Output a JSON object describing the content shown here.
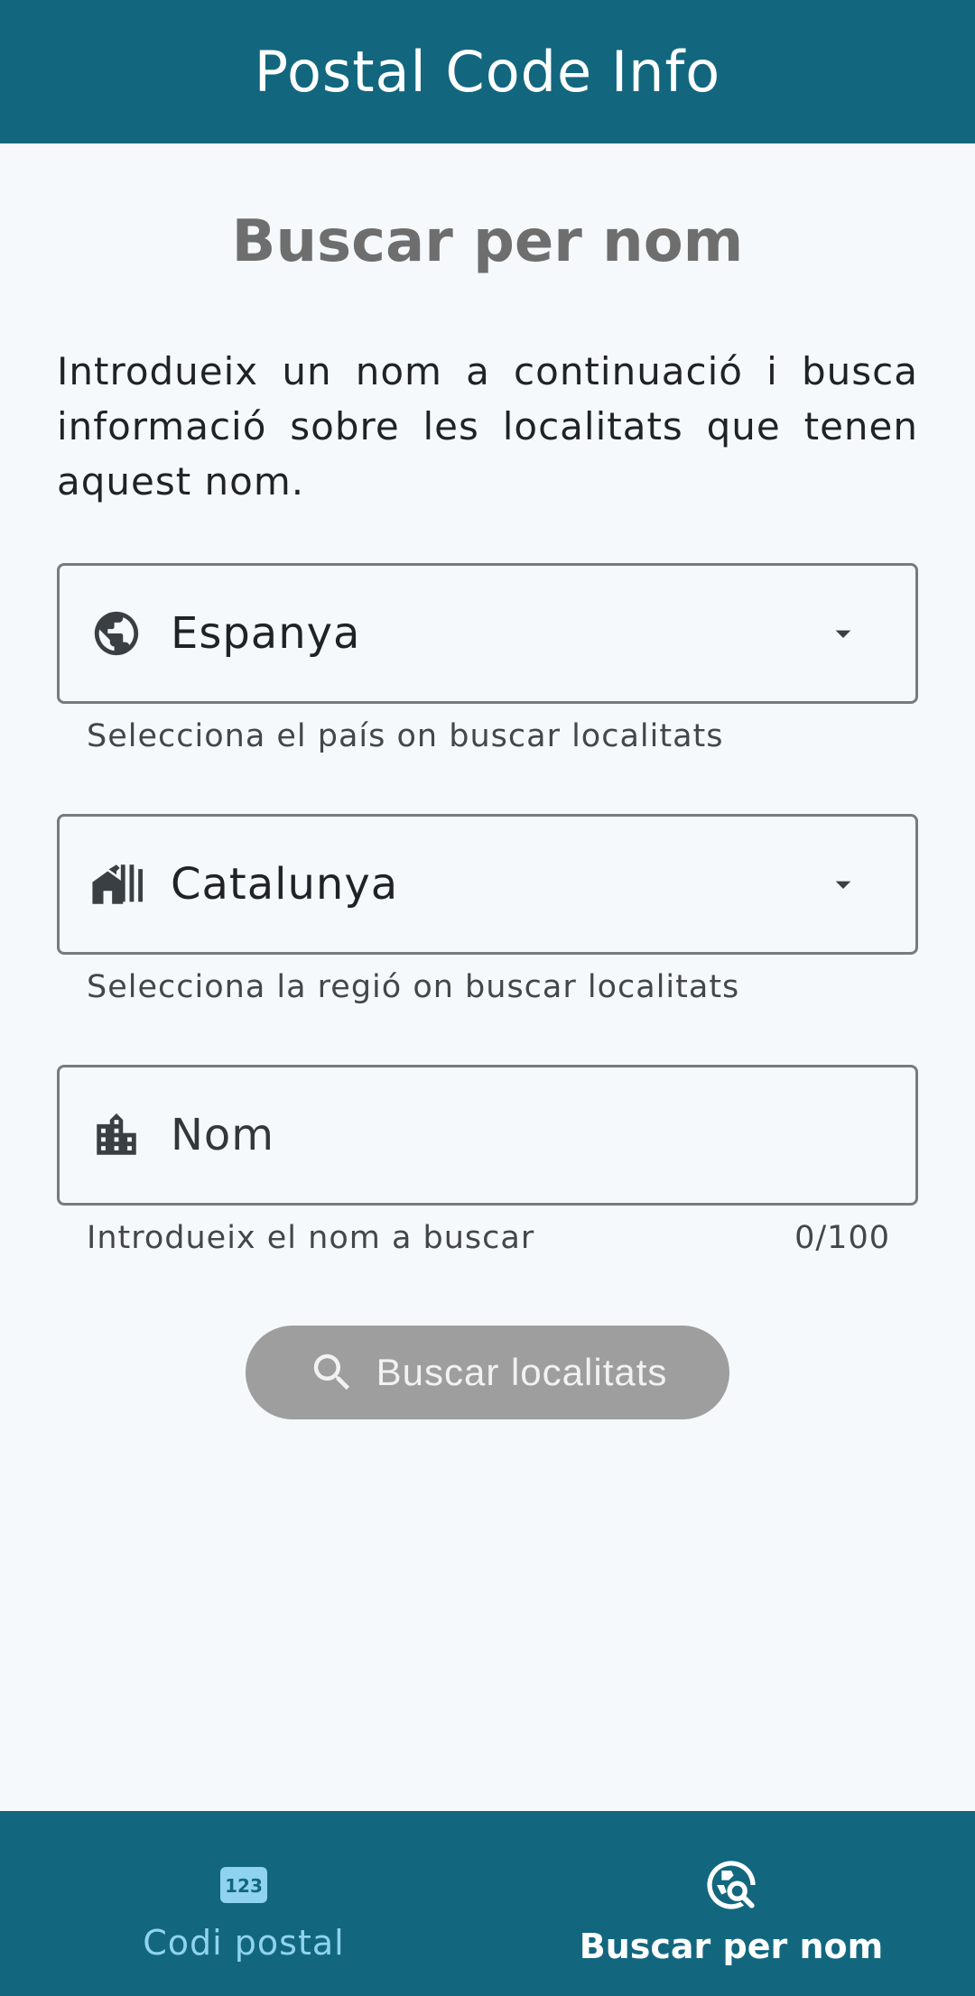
{
  "app_bar": {
    "title": "Postal Code Info"
  },
  "main": {
    "page_title": "Buscar per nom",
    "intro": "Introdueix un nom a continuació i busca informació sobre les localitats que tenen aquest nom.",
    "country_field": {
      "icon": "globe-icon",
      "value": "Espanya",
      "helper": "Selecciona el país on buscar localitats"
    },
    "region_field": {
      "icon": "houses-icon",
      "value": "Catalunya",
      "helper": "Selecciona la regió on buscar localitats"
    },
    "name_field": {
      "icon": "city-buildings-icon",
      "placeholder": "Nom",
      "value": "",
      "helper": "Introdueix el nom a buscar",
      "counter": "0/100"
    },
    "search_button": {
      "icon": "search-icon",
      "label": "Buscar localitats"
    }
  },
  "bottom_nav": {
    "items": [
      {
        "label": "Codi postal",
        "icon": "numeric-123-icon",
        "active": false
      },
      {
        "label": "Buscar per nom",
        "icon": "search-location-icon",
        "active": true
      }
    ]
  },
  "colors": {
    "primary": "#12677f",
    "background": "#f5f9fc",
    "disabled_button": "#9e9e9e",
    "nav_inactive": "#8fd3f0"
  }
}
